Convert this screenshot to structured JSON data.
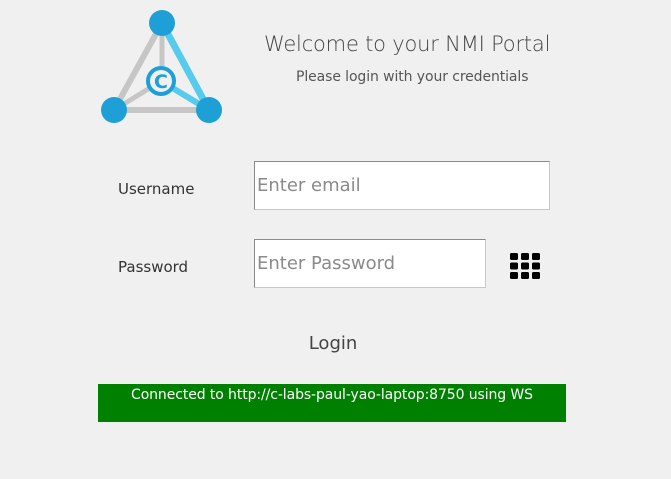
{
  "header": {
    "title": "Welcome to your NMI Portal",
    "subtitle": "Please login with your credentials",
    "logo_icon": "c-labs-triangle-logo"
  },
  "form": {
    "username_label": "Username",
    "username_placeholder": "Enter email",
    "username_value": "",
    "password_label": "Password",
    "password_placeholder": "Enter Password",
    "password_value": "",
    "keypad_icon": "keypad-grid-icon",
    "login_label": "Login"
  },
  "status": {
    "text": "Connected to http://c-labs-paul-yao-laptop:8750 using WS",
    "color": "#008000"
  },
  "colors": {
    "background": "#f0f0f0",
    "logo_blue": "#1e9fd6",
    "logo_light_blue": "#56cbec",
    "logo_gray": "#c6c6c6"
  }
}
